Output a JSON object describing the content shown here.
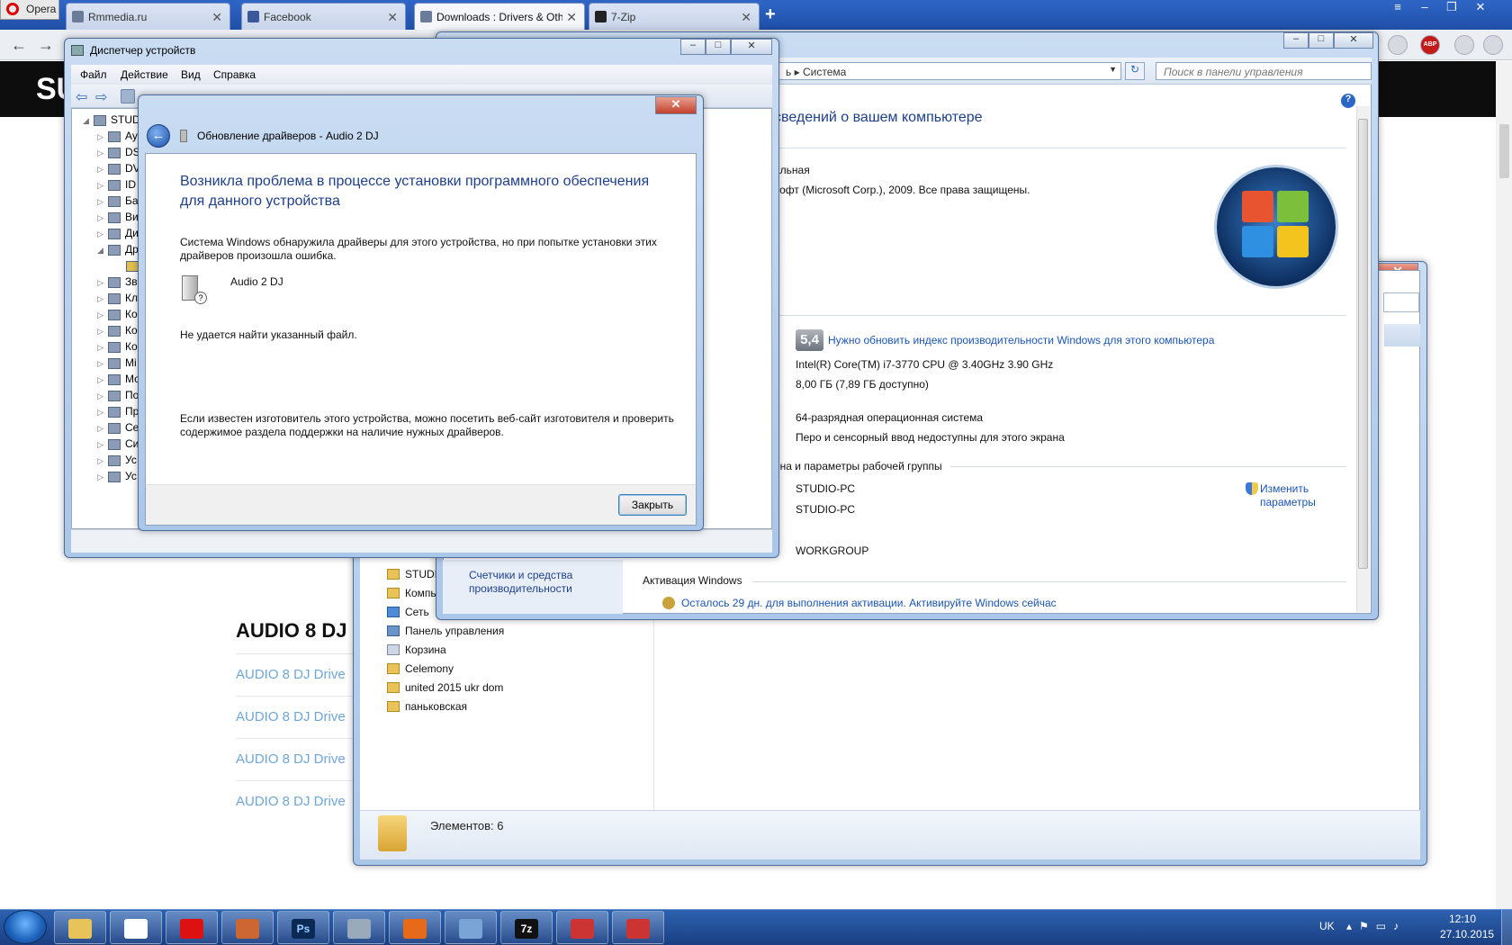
{
  "browser": {
    "menu_label": "Opera",
    "tabs": [
      {
        "title": "Rmmedia.ru"
      },
      {
        "title": "Facebook"
      },
      {
        "title": "Downloads : Drivers & Oth"
      },
      {
        "title": "7-Zip"
      }
    ],
    "new_tab": "+",
    "adblock_badge": "ABP"
  },
  "webpage": {
    "logo_partial": "SU",
    "section_heading": "AUDIO 8 DJ",
    "links": [
      "AUDIO 8 DJ Drive",
      "AUDIO 8 DJ Drive",
      "AUDIO 8 DJ Drive",
      "AUDIO 8 DJ Drive"
    ]
  },
  "device_manager": {
    "title": "Диспетчер устройств",
    "menu": [
      "Файл",
      "Действие",
      "Вид",
      "Справка"
    ],
    "tree_root": "STUD",
    "tree_items": [
      "Ау",
      "DS",
      "DV",
      "ID",
      "Ба",
      "Ви",
      "Ди",
      "Др",
      "",
      "Зв",
      "Кл",
      "Ко",
      "Ко",
      "Ко",
      "Мі",
      "Мо",
      "По",
      "Пр",
      "Се",
      "Си",
      "Ус",
      "Ус"
    ]
  },
  "update_dialog": {
    "title": "Обновление драйверов - Audio 2 DJ",
    "heading": "Возникла проблема в процессе установки программного обеспечения для данного устройства",
    "para1": "Система Windows обнаружила драйверы для этого устройства, но при попытке установки этих драйверов произошла ошибка.",
    "device_name": "Audio 2 DJ",
    "error": "Не удается найти указанный файл.",
    "para2": "Если известен изготовитель этого устройства, можно посетить веб-сайт изготовителя и проверить содержимое раздела поддержки на наличие нужных драйверов.",
    "close_button": "Закрыть"
  },
  "system_window": {
    "address_crumb": "Система",
    "address_prefix": "ь",
    "search_placeholder": "Поиск в панели управления",
    "heading": "сведений о вашем компьютере",
    "edition_partial": "альная",
    "copyright": "софт (Microsoft Corp.), 2009. Все права защищены.",
    "score": "5,4",
    "score_link": "Нужно обновить индекс производительности Windows для этого компьютера",
    "cpu": "Intel(R) Core(TM) i7-3770 CPU @ 3.40GHz   3.90 GHz",
    "ram": "8,00 ГБ (7,89 ГБ доступно)",
    "os_type": "64-разрядная операционная система",
    "pen": "Перо и сенсорный ввод недоступны для этого экрана",
    "group_header": "ена и параметры рабочей группы",
    "computer_name": "STUDIO-PC",
    "full_name": "STUDIO-PC",
    "workgroup": "WORKGROUP",
    "change_link_1": "Изменить",
    "change_link_2": "параметры",
    "activation_header": "Активация Windows",
    "activation_link": "Осталось 29 дн. для выполнения активации. Активируйте Windows сейчас",
    "perf_link_1": "Счетчики и средства",
    "perf_link_2": "производительности"
  },
  "explorer": {
    "nav_items": [
      "STUDI",
      "Компь",
      "Сеть",
      "Панель управления",
      "Корзина",
      "Celemony",
      "united 2015 ukr dom",
      "паньковская"
    ],
    "status": "Элементов: 6"
  },
  "taskbar": {
    "lang": "UK",
    "time": "12:10",
    "date": "27.10.2015",
    "apps": [
      "explorer",
      "daemon-tools",
      "opera",
      "file-app",
      "photoshop",
      "audio-app",
      "firefox",
      "control-panel",
      "7zip",
      "toolbox",
      "toolbox"
    ],
    "labels": {
      "photoshop": "Ps",
      "7zip": "7z"
    }
  }
}
